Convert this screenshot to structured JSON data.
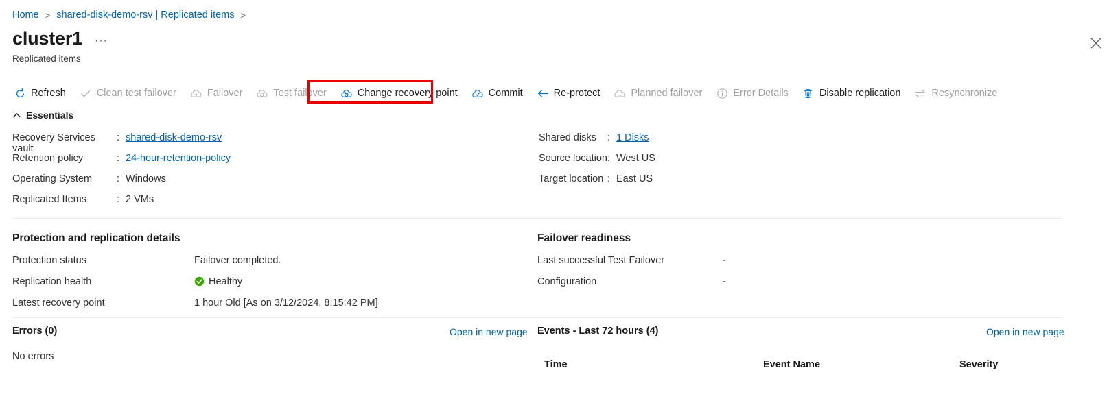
{
  "breadcrumb": {
    "items": [
      {
        "label": "Home",
        "type": "link"
      },
      {
        "label": ">",
        "type": "separator"
      },
      {
        "label": "shared-disk-demo-rsv | Replicated items",
        "type": "link"
      },
      {
        "label": ">",
        "type": "separator"
      }
    ]
  },
  "header": {
    "title": "cluster1",
    "more_button": "···",
    "subtitle": "Replicated items",
    "close_icon": "close-icon"
  },
  "toolbar": {
    "items": [
      {
        "label": "Refresh",
        "icon": "refresh-icon",
        "enabled": true,
        "icon_color": "#0078d4"
      },
      {
        "label": "Clean test failover",
        "icon": "checkmark-icon",
        "enabled": false,
        "icon_color": "#b3b0ad"
      },
      {
        "label": "Failover",
        "icon": "cloud-failover-icon",
        "enabled": false,
        "icon_color": "#b3b0ad"
      },
      {
        "label": "Test failover",
        "icon": "cloud-test-failover-icon",
        "enabled": false,
        "icon_color": "#b3b0ad"
      },
      {
        "label": "Change recovery point",
        "icon": "cloud-recovery-point-icon",
        "enabled": true,
        "icon_color": "#0078d4",
        "highlighted": true
      },
      {
        "label": "Commit",
        "icon": "cloud-check-icon",
        "enabled": true,
        "icon_color": "#0078d4"
      },
      {
        "label": "Re-protect",
        "icon": "arrow-left-icon",
        "enabled": true,
        "icon_color": "#0078d4"
      },
      {
        "label": "Planned failover",
        "icon": "cloud-planned-failover-icon",
        "enabled": false,
        "icon_color": "#b3b0ad"
      },
      {
        "label": "Error Details",
        "icon": "info-circle-icon",
        "enabled": false,
        "icon_color": "#b3b0ad"
      },
      {
        "label": "Disable replication",
        "icon": "trash-icon",
        "enabled": true,
        "icon_color": "#0078d4"
      },
      {
        "label": "Resynchronize",
        "icon": "sync-arrows-icon",
        "enabled": false,
        "icon_color": "#b3b0ad"
      }
    ],
    "highlight_color": "#e60000"
  },
  "essentials": {
    "heading": "Essentials",
    "chevron": "chevron-up-icon",
    "left": [
      {
        "key": "Recovery Services vault",
        "colon": ":",
        "value": "shared-disk-demo-rsv",
        "link": true
      },
      {
        "key": "Retention policy",
        "colon": ":",
        "value": "24-hour-retention-policy",
        "link": true
      },
      {
        "key": "Operating System",
        "colon": ":",
        "value": "Windows",
        "link": false
      },
      {
        "key": "Replicated Items",
        "colon": ":",
        "value": "2 VMs",
        "link": false
      }
    ],
    "right": [
      {
        "key": "Shared disks",
        "colon": ":",
        "value": "1 Disks",
        "link": true
      },
      {
        "key": "Source location",
        "colon": ":",
        "value": "West US",
        "link": false
      },
      {
        "key": "Target location",
        "colon": ":",
        "value": "East US",
        "link": false
      }
    ]
  },
  "protection_details": {
    "title": "Protection and replication details",
    "rows": [
      {
        "key": "Protection status",
        "value": "Failover completed.",
        "status_icon": null
      },
      {
        "key": "Replication health",
        "value": "Healthy",
        "status_icon": "healthy-check-icon"
      },
      {
        "key": "Latest recovery point",
        "value": "1 hour Old [As on 3/12/2024, 8:15:42 PM]",
        "status_icon": null
      }
    ]
  },
  "failover_readiness": {
    "title": "Failover readiness",
    "rows": [
      {
        "key": "Last successful Test Failover",
        "value": "-"
      },
      {
        "key": "Configuration",
        "value": "-"
      }
    ]
  },
  "errors_panel": {
    "title": "Errors (0)",
    "open_link": "Open in new page",
    "empty_message": "No errors"
  },
  "events_panel": {
    "title": "Events - Last 72 hours (4)",
    "open_link": "Open in new page",
    "columns": [
      "Time",
      "Event Name",
      "Severity"
    ]
  }
}
